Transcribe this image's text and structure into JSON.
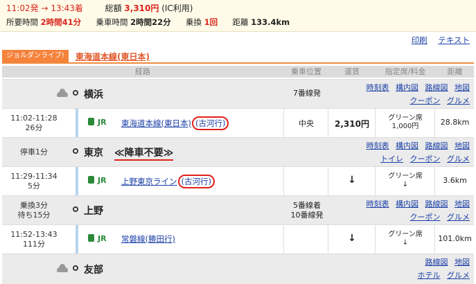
{
  "summary": {
    "depart": "11:02発",
    "arrow": "→",
    "arrive": "13:43着",
    "fare_label": "総額",
    "fare_value": "3,310円",
    "fare_note": "(IC利用)",
    "required_label": "所要時間",
    "required_value": "2時間41分",
    "ride_label": "乗車時間",
    "ride_value": "2時間22分",
    "transfer_label": "乗換",
    "transfer_value": "1回",
    "distance_label": "距離",
    "distance_value": "133.4km"
  },
  "toplinks": {
    "print": "印刷",
    "text": "テキスト"
  },
  "lineinfo": {
    "tag": "ジョルダンライブ!",
    "name": "東海道本線(東日本)"
  },
  "table_headers": {
    "route": "経路",
    "position": "乗車位置",
    "fare": "運賃",
    "seat": "指定席/料金",
    "distance": "距離"
  },
  "stations": [
    {
      "name": "横浜",
      "platform": "7番線発",
      "links1": [
        "時刻表",
        "構内図",
        "路線図",
        "地図"
      ],
      "links2": [
        "クーポン",
        "グルメ"
      ]
    },
    {
      "name": "東京",
      "stop_label": "停車1分",
      "nostop": "≪降車不要≫",
      "links1": [
        "時刻表",
        "構内図",
        "路線図",
        "地図"
      ],
      "links2": [
        "トイレ",
        "クーポン",
        "グルメ"
      ]
    },
    {
      "name": "上野",
      "stop_label1": "乗換3分",
      "stop_label2": "待ち15分",
      "platform1": "5番線着",
      "platform2": "10番線発",
      "links1": [
        "時刻表",
        "構内図",
        "路線図",
        "地図"
      ],
      "links2": [
        "クーポン",
        "グルメ"
      ]
    },
    {
      "name": "友部",
      "links1": [
        "路線図",
        "地図"
      ],
      "links2": [
        "ホテル",
        "グルメ"
      ]
    }
  ],
  "segments": [
    {
      "time": "11:02-11:28",
      "duration": "26分",
      "company": "JR",
      "line": "東海道本線(東日本)",
      "dest": "(古河行)",
      "position": "中央",
      "fare": "2,310円",
      "seat1": "グリーン席",
      "seat2": "1,000円",
      "distance": "28.8km"
    },
    {
      "time": "11:29-11:34",
      "duration": "5分",
      "company": "JR",
      "line": "上野東京ライン",
      "dest": "(古河行)",
      "fare": "↓",
      "seat1": "グリーン席",
      "seat2": "↓",
      "distance": "3.6km"
    },
    {
      "time": "11:52-13:43",
      "duration": "111分",
      "company": "JR",
      "line": "常磐線(勝田行)",
      "fare": "↓",
      "seat1": "グリーン席",
      "seat2": "↓",
      "distance": "101.0km"
    }
  ],
  "colors": {
    "accent": "#f5833c",
    "link": "#1a3fa6",
    "highlight": "#d9261c",
    "jr_green": "#2a8a3a"
  }
}
